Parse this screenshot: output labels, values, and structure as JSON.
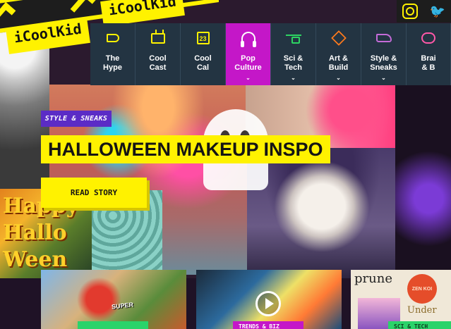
{
  "brand": {
    "logo_text_a": "iCoolKid",
    "logo_text_b": "iCoolKid",
    "accent_color": "#fff200"
  },
  "social": {
    "instagram_icon": "instagram-icon",
    "twitter_icon": "twitter-icon"
  },
  "nav": {
    "items": [
      {
        "label_1": "The",
        "label_2": "Hype",
        "icon": "megaphone-icon",
        "active": false
      },
      {
        "label_1": "Cool",
        "label_2": "Cast",
        "icon": "tv-icon",
        "active": false
      },
      {
        "label_1": "Cool",
        "label_2": "Cal",
        "icon": "calendar-icon",
        "icon_text": "23",
        "active": false
      },
      {
        "label_1": "Pop",
        "label_2": "Culture",
        "icon": "headphones-icon",
        "active": true
      },
      {
        "label_1": "Sci &",
        "label_2": "Tech",
        "icon": "drone-icon",
        "active": false
      },
      {
        "label_1": "Art &",
        "label_2": "Build",
        "icon": "cube-icon",
        "active": false
      },
      {
        "label_1": "Style &",
        "label_2": "Sneaks",
        "icon": "sneaker-icon",
        "active": false
      },
      {
        "label_1": "Brai",
        "label_2": "& B",
        "icon": "brain-icon",
        "active": false
      }
    ],
    "active_color": "#c417c8",
    "background_color": "#233442"
  },
  "hero": {
    "category": "STYLE & SNEAKS",
    "headline": "HALLOWEEN MAKEUP INSPO",
    "cta": "READ STORY",
    "background_sign_text": "Happy Hallo Ween"
  },
  "cards": [
    {
      "overlay_text": "SUPER",
      "tag": ""
    },
    {
      "overlay_text": "",
      "tag": "TRENDS & BIZ",
      "icon": "play-icon"
    },
    {
      "overlay_text_1": "prune",
      "overlay_text_2": "ZEN KOI",
      "overlay_text_3": "Under",
      "tag": "SCI & TECH"
    }
  ]
}
